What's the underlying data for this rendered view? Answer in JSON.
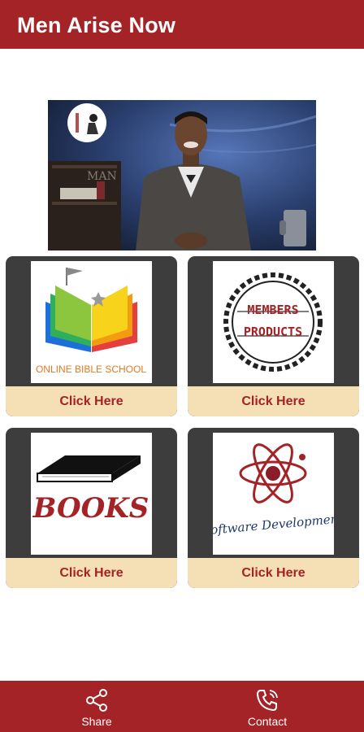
{
  "app": {
    "title": "Men Arise Now"
  },
  "cards": [
    {
      "image_text": "ONLINE BIBLE SCHOOL",
      "button": "Click Here"
    },
    {
      "image_text_line1": "MEMBERS",
      "image_text_line2": "PRODUCTS",
      "button": "Click Here"
    },
    {
      "image_text": "BOOKS",
      "button": "Click Here"
    },
    {
      "image_text": "Software Development",
      "button": "Click Here"
    }
  ],
  "bottom_nav": [
    {
      "label": "Share",
      "icon": "share-icon"
    },
    {
      "label": "Contact",
      "icon": "phone-icon"
    }
  ],
  "colors": {
    "primary": "#a32326",
    "card_bg": "#3d3d3d",
    "button_bg": "#f5dfb5"
  }
}
